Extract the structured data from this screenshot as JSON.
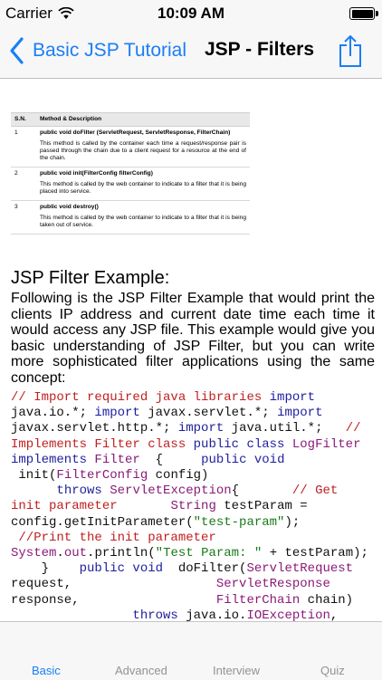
{
  "status_bar": {
    "carrier": "Carrier",
    "time": "10:09 AM",
    "battery_level": 1.0
  },
  "nav": {
    "back_label": "Basic JSP Tutorial",
    "title": "JSP - Filters",
    "accent_color": "#1a7ef6",
    "share_icon": "share-icon"
  },
  "methods_table": {
    "headers": [
      "S.N.",
      "Method & Description"
    ],
    "rows": [
      {
        "sn": "1",
        "method": "public void doFilter (ServletRequest, ServletResponse, FilterChain)",
        "description": "This method is called by the container each time a request/response pair is passed through the chain due to a client request for a resource at the end of the chain."
      },
      {
        "sn": "2",
        "method": "public void init(FilterConfig filterConfig)",
        "description": "This method is called by the web container to indicate to a filter that it is being placed into service."
      },
      {
        "sn": "3",
        "method": "public void destroy()",
        "description": "This method is called by the web container to indicate to a filter that it is being taken out of service."
      }
    ]
  },
  "heading": "JSP Filter Example:",
  "intro": "Following is the JSP Filter Example that would print the clients IP address and current date time each time it would access any JSP file. This example would give you basic understanding of JSP Filter, but you can write more sophisticated filter applications using the same concept:",
  "code": {
    "lines": [
      [
        {
          "t": "// Import required java libraries ",
          "c": "com"
        },
        {
          "t": "import",
          "c": "kw"
        }
      ],
      [
        {
          "t": "java.io.*; ",
          "c": ""
        },
        {
          "t": "import",
          "c": "kw"
        },
        {
          "t": " javax.servlet.*; ",
          "c": ""
        },
        {
          "t": "import",
          "c": "kw"
        }
      ],
      [
        {
          "t": "javax.servlet.http.*; ",
          "c": ""
        },
        {
          "t": "import",
          "c": "kw"
        },
        {
          "t": " java.util.*;   ",
          "c": ""
        },
        {
          "t": "//",
          "c": "com"
        }
      ],
      [
        {
          "t": "Implements Filter class ",
          "c": "com"
        },
        {
          "t": "public class",
          "c": "kw"
        },
        {
          "t": " ",
          "c": ""
        },
        {
          "t": "LogFilter",
          "c": "cls"
        }
      ],
      [
        {
          "t": "implements",
          "c": "kw"
        },
        {
          "t": " ",
          "c": ""
        },
        {
          "t": "Filter",
          "c": "cls"
        },
        {
          "t": "  {     ",
          "c": ""
        },
        {
          "t": "public void",
          "c": "kw"
        }
      ],
      [
        {
          "t": " init(",
          "c": ""
        },
        {
          "t": "FilterConfig",
          "c": "cls"
        },
        {
          "t": " config)",
          "c": ""
        }
      ],
      [
        {
          "t": "      ",
          "c": ""
        },
        {
          "t": "throws",
          "c": "kw"
        },
        {
          "t": " ",
          "c": ""
        },
        {
          "t": "ServletException",
          "c": "cls"
        },
        {
          "t": "{       ",
          "c": ""
        },
        {
          "t": "// Get",
          "c": "com"
        }
      ],
      [
        {
          "t": "init parameter",
          "c": "com"
        },
        {
          "t": "       ",
          "c": ""
        },
        {
          "t": "String",
          "c": "cls"
        },
        {
          "t": " testParam =",
          "c": ""
        }
      ],
      [
        {
          "t": "config.getInitParameter(",
          "c": ""
        },
        {
          "t": "\"test-param\"",
          "c": "str"
        },
        {
          "t": ");",
          "c": ""
        }
      ],
      [
        {
          "t": " //Print the init parameter",
          "c": "com"
        }
      ],
      [
        {
          "t": "System",
          "c": "cls"
        },
        {
          "t": ".",
          "c": ""
        },
        {
          "t": "out",
          "c": "cls"
        },
        {
          "t": ".println(",
          "c": ""
        },
        {
          "t": "\"Test Param: \"",
          "c": "str"
        },
        {
          "t": " + testParam);",
          "c": ""
        }
      ],
      [
        {
          "t": "    }    ",
          "c": ""
        },
        {
          "t": "public void",
          "c": "kw"
        },
        {
          "t": "  doFilter(",
          "c": ""
        },
        {
          "t": "ServletRequest",
          "c": "cls"
        }
      ],
      [
        {
          "t": "request,                   ",
          "c": ""
        },
        {
          "t": "ServletResponse",
          "c": "cls"
        }
      ],
      [
        {
          "t": "response,                  ",
          "c": ""
        },
        {
          "t": "FilterChain",
          "c": "cls"
        },
        {
          "t": " chain)",
          "c": ""
        }
      ],
      [
        {
          "t": "                ",
          "c": ""
        },
        {
          "t": "throws",
          "c": "kw"
        },
        {
          "t": " java.io.",
          "c": ""
        },
        {
          "t": "IOException",
          "c": "cls"
        },
        {
          "t": ",",
          "c": ""
        }
      ]
    ]
  },
  "tabs": [
    {
      "label": "Basic",
      "active": true
    },
    {
      "label": "Advanced",
      "active": false
    },
    {
      "label": "Interview",
      "active": false
    },
    {
      "label": "Quiz",
      "active": false
    }
  ]
}
